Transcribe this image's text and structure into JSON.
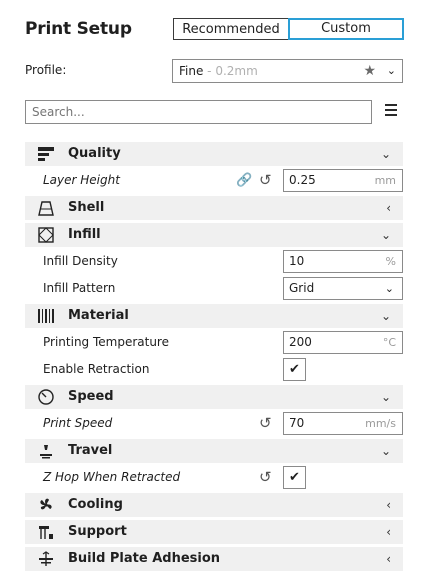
{
  "header": {
    "title": "Print Setup",
    "mode_recommended": "Recommended",
    "mode_custom": "Custom"
  },
  "profile": {
    "label": "Profile:",
    "value": "Fine",
    "sub": " - 0.2mm"
  },
  "search": {
    "placeholder": "Search..."
  },
  "sections": {
    "quality": "Quality",
    "shell": "Shell",
    "infill": "Infill",
    "material": "Material",
    "speed": "Speed",
    "travel": "Travel",
    "cooling": "Cooling",
    "support": "Support",
    "adhesion": "Build Plate Adhesion"
  },
  "settings": {
    "layer_height": {
      "label": "Layer Height",
      "value": "0.25",
      "unit": "mm"
    },
    "infill_density": {
      "label": "Infill Density",
      "value": "10",
      "unit": "%"
    },
    "infill_pattern": {
      "label": "Infill Pattern",
      "value": "Grid"
    },
    "print_temp": {
      "label": "Printing Temperature",
      "value": "200",
      "unit": "°C"
    },
    "enable_retraction": {
      "label": "Enable Retraction",
      "checked": true
    },
    "print_speed": {
      "label": "Print Speed",
      "value": "70",
      "unit": "mm/s"
    },
    "z_hop": {
      "label": "Z Hop When Retracted",
      "checked": true
    }
  },
  "icons": {
    "quality": "quality-bars-icon",
    "shell": "shell-icon",
    "infill": "infill-icon",
    "material": "material-spool-icon",
    "speed": "speed-gauge-icon",
    "travel": "travel-icon",
    "cooling": "cooling-fan-icon",
    "support": "support-icon",
    "adhesion": "adhesion-icon",
    "link": "link-icon",
    "reset": "reset-icon",
    "star": "star-icon",
    "menu": "hamburger-menu-icon"
  },
  "colors": {
    "accent": "#2a9fd6",
    "category_bg": "#f0f0f0",
    "text": "#1f1f1f"
  }
}
